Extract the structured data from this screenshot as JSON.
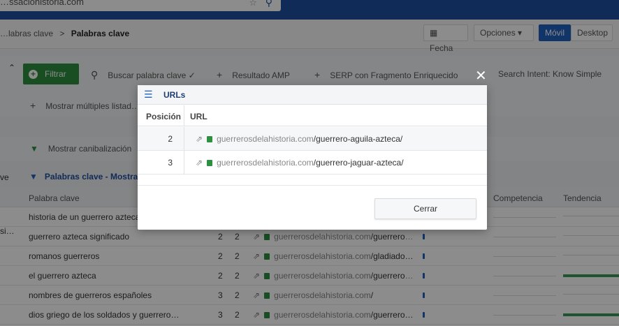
{
  "browser": {
    "url_fragment": "…ssacionistoria.com",
    "star_icon": "star-icon",
    "search_icon": "search-icon"
  },
  "breadcrumb": {
    "parent": "…labras clave",
    "separator": ">",
    "current": "Palabras clave"
  },
  "toolbar": {
    "fecha": "Fecha",
    "opciones": "Opciones",
    "movil": "Móvil",
    "desktop": "Desktop"
  },
  "filters": {
    "filtrar": "Filtrar",
    "search_kw": "Buscar palabra clave",
    "amp": "Resultado AMP",
    "serp": "SERP con Fragmento Enriquecido",
    "intent": "Search Intent: Know Simple",
    "multiple": "Mostrar múltiples listad…",
    "canibal": "Mostrar canibalización"
  },
  "results": {
    "left_label": "ve",
    "title": "Palabras clave - Mostra…"
  },
  "table": {
    "headers": {
      "keyword": "Palabra clave",
      "competencia": "Competencia",
      "tendencia": "Tendencia"
    },
    "rows": [
      {
        "keyword": "historia de un guerrero azteca",
        "pos": "",
        "n2": "",
        "domain": "",
        "path": ""
      },
      {
        "keyword": "guerrero azteca significado",
        "pos": "2",
        "n2": "2",
        "domain": "guerrerosdelahistoria.com",
        "path": "/guerrero-…"
      },
      {
        "keyword": "romanos guerreros",
        "pos": "2",
        "n2": "2",
        "domain": "guerrerosdelahistoria.com",
        "path": "/gladiado…"
      },
      {
        "keyword": "el guerrero azteca",
        "pos": "2",
        "n2": "2",
        "domain": "guerrerosdelahistoria.com",
        "path": "/guerrero-…"
      },
      {
        "keyword": "nombres de guerreros españoles",
        "pos": "3",
        "n2": "2",
        "domain": "guerrerosdelahistoria.com",
        "path": "/"
      },
      {
        "keyword": "dios griego de los soldados y guerreros …",
        "pos": "3",
        "n2": "2",
        "domain": "guerrerosdelahistoria.com",
        "path": "/guerrero…"
      }
    ],
    "left_fragment": "si…"
  },
  "modal": {
    "title": "URLs",
    "col_position": "Posición",
    "col_url": "URL",
    "rows": [
      {
        "pos": "2",
        "domain": "guerrerosdelahistoria.com",
        "path": "/guerrero-aguila-azteca/"
      },
      {
        "pos": "3",
        "domain": "guerrerosdelahistoria.com",
        "path": "/guerrero-jaguar-azteca/"
      }
    ],
    "close_button": "Cerrar",
    "close_x": "✕"
  },
  "colors": {
    "brand_blue": "#1f4fa0",
    "green": "#2d8f3f",
    "active_blue": "#1f5fbf"
  }
}
